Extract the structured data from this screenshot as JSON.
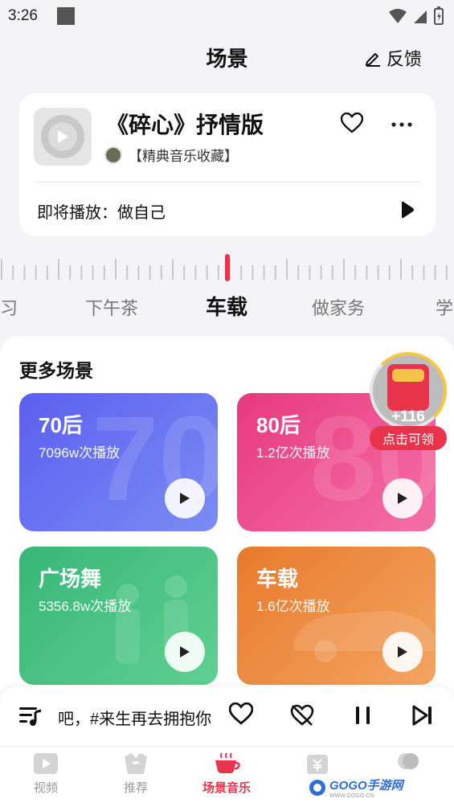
{
  "status_bar": {
    "time": "3:26"
  },
  "header": {
    "title": "场景",
    "feedback_label": "反馈"
  },
  "now_playing": {
    "title": "《碎心》抒情版",
    "album": "【精典音乐收藏】",
    "next_label": "即将播放：做自己"
  },
  "scene_tabs": [
    {
      "label": "习",
      "active": false
    },
    {
      "label": "下午茶",
      "active": false
    },
    {
      "label": "车载",
      "active": true
    },
    {
      "label": "做家务",
      "active": false
    },
    {
      "label": "学",
      "active": false
    }
  ],
  "more_scenes": {
    "title": "更多场景",
    "cards": [
      {
        "name": "70后",
        "plays": "7096w次播放",
        "bg_text": "70",
        "color_from": "#5b5ff0",
        "color_to": "#7b8cf3"
      },
      {
        "name": "80后",
        "plays": "1.2亿次播放",
        "bg_text": "80",
        "color_from": "#e7397e",
        "color_to": "#f56fa6"
      },
      {
        "name": "广场舞",
        "plays": "5356.8w次播放",
        "bg_text": "",
        "color_from": "#38b777",
        "color_to": "#5fd091"
      },
      {
        "name": "车载",
        "plays": "1.6亿次播放",
        "bg_text": "",
        "color_from": "#e87a2b",
        "color_to": "#f3a461"
      }
    ]
  },
  "reward": {
    "amount": "+116",
    "label": "点击可领"
  },
  "player": {
    "lyric": "吧，#来生再去拥抱你"
  },
  "bottom_nav": [
    {
      "label": "视频",
      "icon": "video-icon",
      "active": false
    },
    {
      "label": "推荐",
      "icon": "recommend-icon",
      "active": false
    },
    {
      "label": "场景音乐",
      "icon": "coffee-cup-icon",
      "active": true
    },
    {
      "label": "福利",
      "icon": "gift-icon",
      "active": false
    },
    {
      "label": "",
      "icon": "profile-icon",
      "active": false
    }
  ],
  "watermark": {
    "text": "GOGO手游网",
    "sub": "WWW.GOGO.CN"
  },
  "colors": {
    "accent": "#e8334a",
    "text": "#111111",
    "muted": "#999999"
  }
}
